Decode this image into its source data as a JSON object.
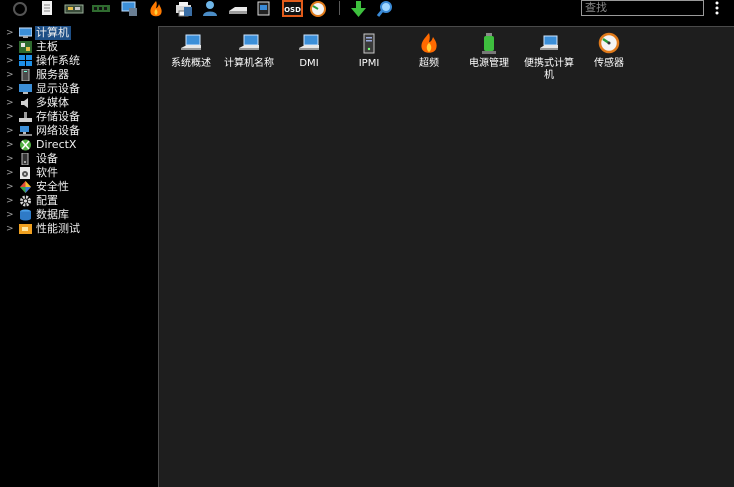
{
  "toolbar": {
    "icons": [
      "refresh-icon",
      "report-icon",
      "motherboard-icon",
      "memory-icon",
      "computer-icon",
      "flame-icon",
      "printer-icon",
      "user-icon",
      "drive-icon",
      "monitor-icon",
      "osd-icon",
      "gauge-icon",
      "download-icon",
      "search-zoom-icon",
      "more-menu-icon"
    ],
    "osd_text": "OSD",
    "search_placeholder": "查找"
  },
  "tree": {
    "items": [
      {
        "label": "计算机",
        "icon": "computer-icon",
        "selected": true
      },
      {
        "label": "主板",
        "icon": "motherboard-icon"
      },
      {
        "label": "操作系统",
        "icon": "windows-icon"
      },
      {
        "label": "服务器",
        "icon": "server-icon"
      },
      {
        "label": "显示设备",
        "icon": "display-icon"
      },
      {
        "label": "多媒体",
        "icon": "speaker-icon"
      },
      {
        "label": "存储设备",
        "icon": "storage-icon"
      },
      {
        "label": "网络设备",
        "icon": "network-icon"
      },
      {
        "label": "DirectX",
        "icon": "xbox-icon"
      },
      {
        "label": "设备",
        "icon": "device-icon"
      },
      {
        "label": "软件",
        "icon": "software-icon"
      },
      {
        "label": "安全性",
        "icon": "security-icon"
      },
      {
        "label": "配置",
        "icon": "config-icon"
      },
      {
        "label": "数据库",
        "icon": "database-icon"
      },
      {
        "label": "性能测试",
        "icon": "benchmark-icon"
      }
    ]
  },
  "content": {
    "tiles": [
      {
        "label": "系统概述",
        "icon": "laptop-icon"
      },
      {
        "label": "计算机名称",
        "icon": "laptop-icon"
      },
      {
        "label": "DMI",
        "icon": "laptop-icon"
      },
      {
        "label": "IPMI",
        "icon": "server-tower-icon"
      },
      {
        "label": "超频",
        "icon": "flame-icon"
      },
      {
        "label": "电源管理",
        "icon": "battery-icon"
      },
      {
        "label": "便携式计算机",
        "icon": "notebook-icon"
      },
      {
        "label": "传感器",
        "icon": "gauge-icon"
      }
    ]
  },
  "colors": {
    "selection": "#1e4f86",
    "pane_bg": "#1e1e1e",
    "window_bg": "#000000"
  }
}
